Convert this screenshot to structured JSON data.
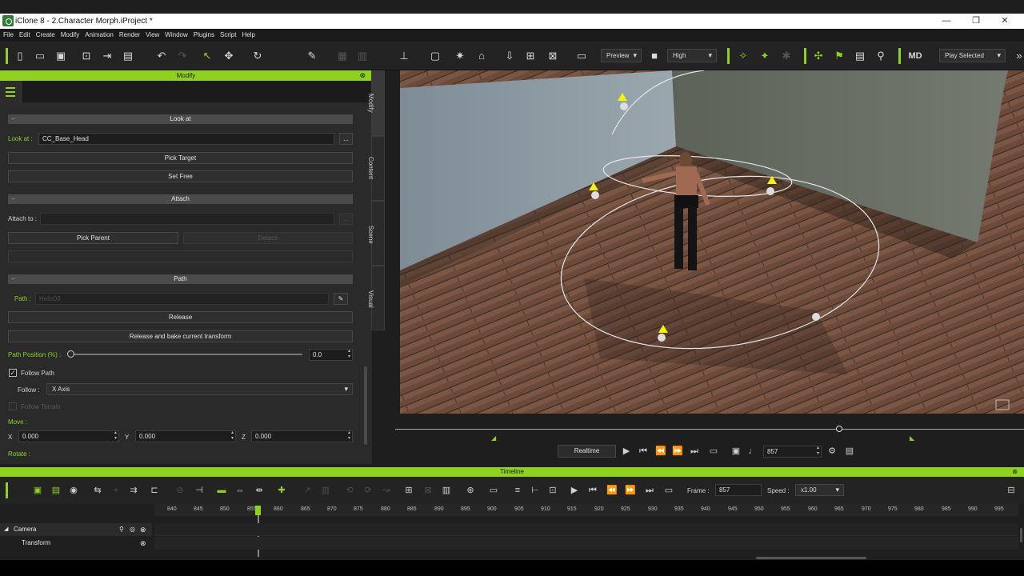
{
  "window": {
    "title": "iClone 8 - 2.Character Morph.iProject *",
    "minimize": "—",
    "maximize": "❐",
    "close": "✕"
  },
  "menu": [
    "File",
    "Edit",
    "Create",
    "Modify",
    "Animation",
    "Render",
    "View",
    "Window",
    "Plugins",
    "Script",
    "Help"
  ],
  "toolbar": {
    "preview_mode": "Preview",
    "quality": "High",
    "play_mode": "Play Selected"
  },
  "modify_panel": {
    "title": "Modify",
    "look_at": {
      "section": "Look at",
      "label": "Look at :",
      "value": "CC_Base_Head",
      "browse": "...",
      "pick_target": "Pick Target",
      "set_free": "Set Free"
    },
    "attach": {
      "section": "Attach",
      "label": "Attach to :",
      "value": "",
      "browse": "...",
      "pick_parent": "Pick Parent",
      "detach": "Detach"
    },
    "path": {
      "section": "Path",
      "label": "Path :",
      "value": "Helix03",
      "release": "Release",
      "release_bake": "Release and bake current transform",
      "position_label": "Path Position (%) :",
      "position_value": "0.0",
      "position_fraction": 0.0,
      "follow_path_label": "Follow Path",
      "follow_path_checked": true,
      "follow_label": "Follow :",
      "follow_value": "X Axis",
      "follow_terrain_label": "Follow Terrain"
    },
    "move": {
      "label": "Move :",
      "x_label": "X",
      "x": "0.000",
      "y_label": "Y",
      "y": "0.000",
      "z_label": "Z",
      "z": "0.000"
    },
    "rotate_label": "Rotate :"
  },
  "side_tabs": [
    "Modify",
    "Content",
    "Scene",
    "Visual"
  ],
  "playback": {
    "realtime": "Realtime",
    "frame": "857"
  },
  "timeline": {
    "title": "Timeline",
    "frame_label": "Frame :",
    "frame_value": "857",
    "speed_label": "Speed :",
    "speed_value": "x1.00",
    "ruler_ticks": [
      "840",
      "845",
      "850",
      "855",
      "860",
      "865",
      "870",
      "875",
      "880",
      "885",
      "890",
      "895",
      "900",
      "905",
      "910",
      "915",
      "920",
      "925",
      "930",
      "935",
      "940",
      "945",
      "950",
      "955",
      "960",
      "965",
      "970",
      "975",
      "980",
      "985",
      "990",
      "995"
    ],
    "tracks": [
      {
        "name": "Camera"
      },
      {
        "name": "Transform"
      }
    ]
  },
  "colors": {
    "accent": "#8fd21e",
    "panel_bg": "#2a2a2a"
  }
}
